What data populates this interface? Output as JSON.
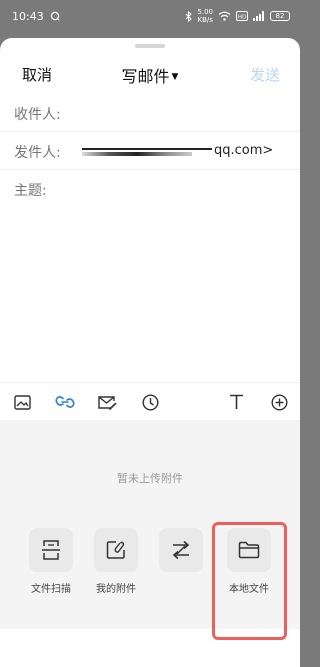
{
  "status_bar": {
    "time": "10:43",
    "speed_value": "5.00",
    "speed_unit": "KB/s",
    "battery": "82"
  },
  "compose": {
    "cancel_label": "取消",
    "title": "写邮件",
    "send_label": "发送",
    "to_label": "收件人:",
    "from_label": "发件人:",
    "from_value_suffix": "qq.com>",
    "subject_label": "主题:"
  },
  "toolbar": {
    "icons": [
      "image-icon",
      "link-icon",
      "mail-edit-icon",
      "clock-icon",
      "text-format-icon",
      "add-icon"
    ]
  },
  "attachments": {
    "empty_text": "暂未上传附件",
    "options": [
      {
        "label": "文件扫描",
        "icon": "scan-icon"
      },
      {
        "label": "我的附件",
        "icon": "attachment-icon"
      },
      {
        "label": "",
        "icon": "transfer-icon"
      },
      {
        "label": "本地文件",
        "icon": "folder-icon"
      }
    ]
  },
  "colors": {
    "accent": "#2f7fd6",
    "send_disabled": "#b9d6f2",
    "highlight": "#ef5d5d"
  }
}
